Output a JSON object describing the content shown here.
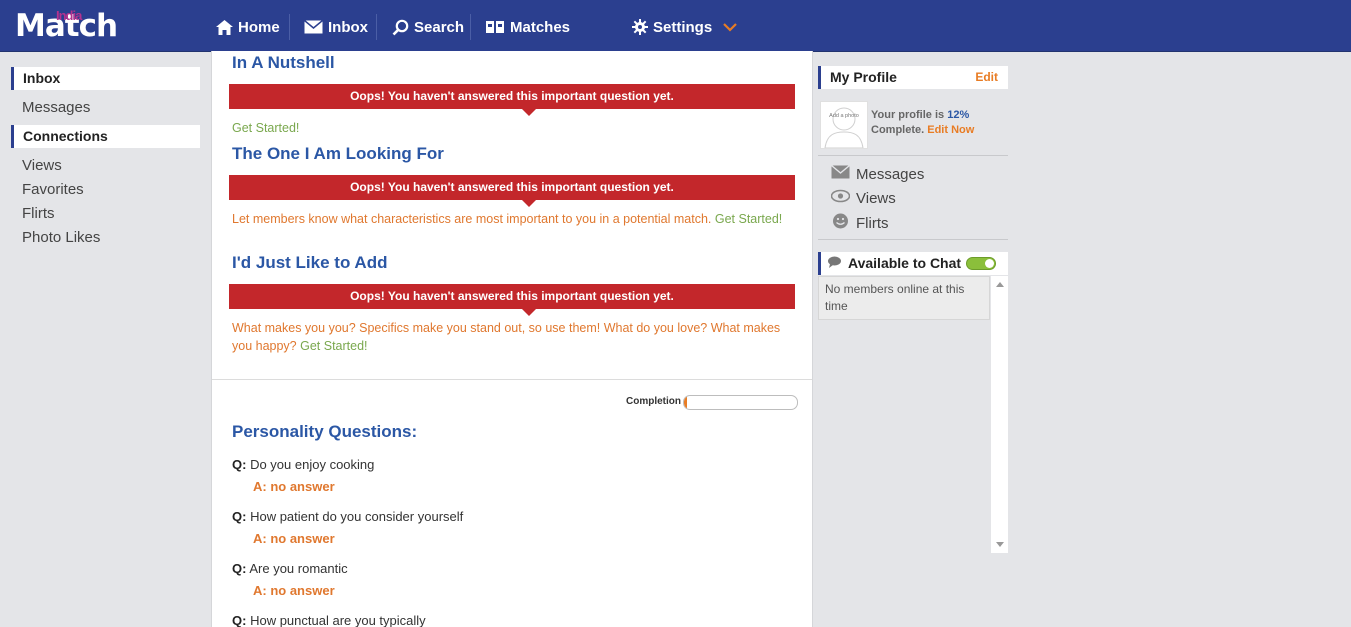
{
  "brand": {
    "part1": "India",
    "part2": "Match"
  },
  "nav": {
    "home": "Home",
    "inbox": "Inbox",
    "search": "Search",
    "matches": "Matches",
    "settings": "Settings"
  },
  "left_nav": {
    "inbox_head": "Inbox",
    "messages": "Messages",
    "connections_head": "Connections",
    "views": "Views",
    "favorites": "Favorites",
    "flirts": "Flirts",
    "photo_likes": "Photo Likes"
  },
  "main": {
    "sections": [
      {
        "title": "In A Nutshell",
        "alert": "Oops! You haven't answered this important question yet.",
        "desc": "",
        "cta": "Get Started!"
      },
      {
        "title": "The One I Am Looking For",
        "alert": "Oops! You haven't answered this important question yet.",
        "desc": "Let members know what characteristics are most important to you in a potential match.",
        "cta": "Get Started!"
      },
      {
        "title": "I'd Just Like to Add",
        "alert": "Oops! You haven't answered this important question yet.",
        "desc": "What makes you you? Specifics make you stand out, so use them! What do you love? What makes you happy?",
        "cta": "Get Started!"
      }
    ],
    "completion_label": "Completion",
    "completion_value": 0.03,
    "personality_title": "Personality Questions:",
    "q_prefix": "Q:",
    "questions": [
      {
        "q": "Do you enjoy cooking",
        "a": "A: no answer"
      },
      {
        "q": "How patient do you consider yourself",
        "a": "A: no answer"
      },
      {
        "q": "Are you romantic",
        "a": "A: no answer"
      },
      {
        "q": "How punctual are you typically",
        "a": ""
      }
    ]
  },
  "right": {
    "profile_head": "My Profile",
    "edit": "Edit",
    "avatar_text": "Add a photo",
    "status_prefix": "Your profile is",
    "status_pct": "12%",
    "status_suffix": "Complete.",
    "edit_now": "Edit Now",
    "messages": "Messages",
    "views": "Views",
    "flirts": "Flirts",
    "chat_head": "Available to Chat",
    "chat_empty": "No members online at this time"
  },
  "colors": {
    "nav_bg": "#2b3f8f",
    "accent": "#e87c24",
    "alert": "#c3272b",
    "title": "#2b57a5",
    "cta": "#7aa84e"
  }
}
